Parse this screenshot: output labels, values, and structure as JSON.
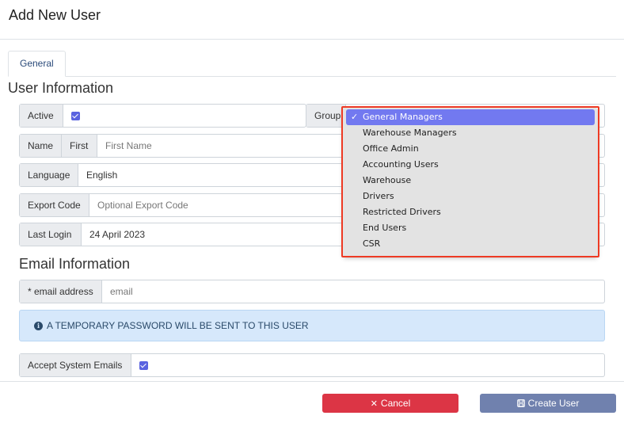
{
  "header": {
    "title": "Add New User"
  },
  "tabs": [
    {
      "label": "General"
    }
  ],
  "user_info": {
    "section_title": "User Information",
    "active": {
      "label": "Active",
      "checked": true
    },
    "group": {
      "label": "Group"
    },
    "name": {
      "label": "Name",
      "first_label": "First",
      "first_placeholder": "First Name"
    },
    "language": {
      "label": "Language",
      "value": "English"
    },
    "export_code": {
      "label": "Export Code",
      "placeholder": "Optional Export Code"
    },
    "last_login": {
      "label": "Last Login",
      "value": "24 April 2023"
    }
  },
  "email_info": {
    "section_title": "Email Information",
    "email": {
      "label": "* email address",
      "placeholder": "email"
    },
    "alert": "A TEMPORARY PASSWORD WILL BE SENT TO THIS USER",
    "accept": {
      "label": "Accept System Emails",
      "checked": true
    }
  },
  "group_dropdown": {
    "selected": "General Managers",
    "options": [
      "General Managers",
      "Warehouse Managers",
      "Office Admin",
      "Accounting Users",
      "Warehouse",
      "Drivers",
      "Restricted Drivers",
      "End Users",
      "CSR"
    ]
  },
  "footer": {
    "cancel_label": "Cancel",
    "create_label": "Create User"
  },
  "colors": {
    "primary_check": "#5a63e0",
    "cancel": "#dc3545",
    "create": "#7081ae",
    "highlight": "#ee3a24",
    "selected_option": "#7279f0"
  }
}
